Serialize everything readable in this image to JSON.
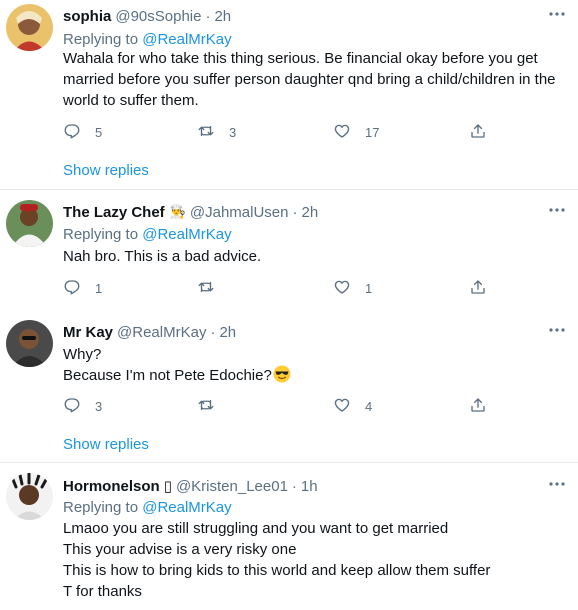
{
  "tweets": [
    {
      "name": "sophia",
      "handle": "@90sSophie",
      "dot": "·",
      "time": "2h",
      "replying_prefix": "Replying to",
      "replying_to": "@RealMrKay",
      "lines": [
        "Wahala for who take this thing serious. Be financial okay before you get",
        "married before you suffer person daughter qnd bring a child/children in the",
        "world to suffer them."
      ],
      "replies": "5",
      "retweets": "3",
      "likes": "17",
      "show_replies": "Show replies"
    },
    {
      "name": "The Lazy Chef",
      "name_emoji": "👨‍🍳",
      "handle": "@JahmalUsen",
      "dot": "·",
      "time": "2h",
      "replying_prefix": "Replying to",
      "replying_to": "@RealMrKay",
      "lines": [
        "Nah bro. This is a bad advice."
      ],
      "replies": "1",
      "retweets": "",
      "likes": "1"
    },
    {
      "name": "Mr Kay",
      "handle": "@RealMrKay",
      "dot": "·",
      "time": "2h",
      "lines": [
        "Why?",
        "Because I'm not Pete Edochie?"
      ],
      "replies": "3",
      "retweets": "",
      "likes": "4",
      "show_replies": "Show replies"
    },
    {
      "name": "Hormonelson",
      "name_suffix": "▯",
      "handle": "@Kristen_Lee01",
      "dot": "·",
      "time": "1h",
      "replying_prefix": "Replying to",
      "replying_to": "@RealMrKay",
      "lines": [
        "Lmaoo you are still struggling and you want to get married",
        "This your advise is a very risky one",
        "This is how to bring kids to this world and keep allow them suffer",
        "T for thanks"
      ]
    }
  ],
  "icons": {
    "more": "more-icon",
    "reply": "reply-icon",
    "retweet": "retweet-icon",
    "like": "like-icon",
    "share": "share-icon",
    "emoji": "smiling-face-with-sunglasses-icon"
  },
  "colors": {
    "accent": "#1b95e0",
    "secondary_text": "#5b7083",
    "divider": "#e6ecf0"
  }
}
